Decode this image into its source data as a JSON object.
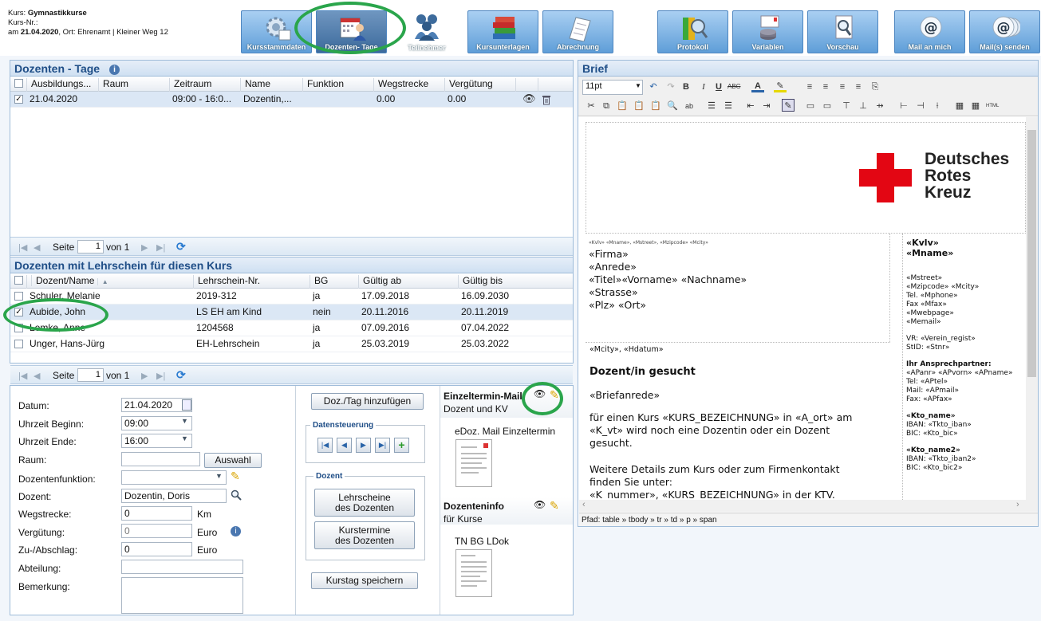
{
  "course": {
    "line1_label": "Kurs:",
    "line1_value": "Gymnastikkurse",
    "line2": "Kurs-Nr.:",
    "line3_pre": "am ",
    "line3_date": "21.04.2020",
    "line3_rest": ", Ort: Ehrenamt | Kleiner Weg 12"
  },
  "toolbar": {
    "kursstammdaten": "Kursstammdaten",
    "dozenten_tage": "Dozenten- Tage",
    "teilnehmer": "Teilnehmer",
    "kursunterlagen": "Kursunterlagen",
    "abrechnung": "Abrechnung",
    "protokoll": "Protokoll",
    "variablen": "Variablen",
    "vorschau": "Vorschau",
    "mail_an_mich": "Mail an mich",
    "mails_senden": "Mail(s) senden"
  },
  "colors": {
    "accent": "#1f4e87",
    "ring": "#2aa54b",
    "drk_red": "#e30613"
  },
  "tage": {
    "title": "Dozenten - Tage",
    "columns": [
      "Ausbildungs...",
      "Raum",
      "Zeitraum",
      "Name",
      "Funktion",
      "Wegstrecke",
      "Vergütung"
    ],
    "rows": [
      {
        "datum": "21.04.2020",
        "raum": "",
        "zeit": "09:00 - 16:0...",
        "name": "Dozentin,...",
        "funktion": "",
        "weg": "0.00",
        "verg": "0.00",
        "checked": true
      }
    ]
  },
  "pager1": {
    "seite": "Seite",
    "page": "1",
    "von": "von 1"
  },
  "lehrschein": {
    "title": "Dozenten mit Lehrschein für diesen Kurs",
    "columns": [
      "Dozent/Name",
      "Lehrschein-Nr.",
      "BG",
      "Gültig ab",
      "Gültig bis"
    ],
    "rows": [
      {
        "name": "Schuler, Melanie",
        "nr": "2019-312",
        "bg": "ja",
        "ab": "17.09.2018",
        "bis": "16.09.2030",
        "checked": false
      },
      {
        "name": "Aubide, John",
        "nr": "LS EH am Kind",
        "bg": "nein",
        "ab": "20.11.2016",
        "bis": "20.11.2019",
        "checked": true
      },
      {
        "name": "Lemke, Anne",
        "nr": "1204568",
        "bg": "ja",
        "ab": "07.09.2016",
        "bis": "07.04.2022",
        "checked": false
      },
      {
        "name": "Unger, Hans-Jürg",
        "nr": "EH-Lehrschein",
        "bg": "ja",
        "ab": "25.03.2019",
        "bis": "25.03.2022",
        "checked": false
      }
    ]
  },
  "pager2": {
    "seite": "Seite",
    "page": "1",
    "von": "von 1"
  },
  "form": {
    "datum_label": "Datum:",
    "datum": "21.04.2020",
    "beginn_label": "Uhrzeit Beginn:",
    "beginn": "09:00",
    "ende_label": "Uhrzeit Ende:",
    "ende": "16:00",
    "raum_label": "Raum:",
    "raum": "",
    "auswahl": "Auswahl",
    "funktion_label": "Dozentenfunktion:",
    "funktion": "",
    "dozent_label": "Dozent:",
    "dozent": "Dozentin, Doris",
    "weg_label": "Wegstrecke:",
    "weg": "0",
    "km": "Km",
    "verg_label": "Vergütung:",
    "verg": "0",
    "euro1": "Euro",
    "zu_label": "Zu-/Abschlag:",
    "zu": "0",
    "euro2": "Euro",
    "abt_label": "Abteilung:",
    "abt": "",
    "bem_label": "Bemerkung:",
    "bem": ""
  },
  "actions": {
    "add_tag": "Doz./Tag hinzufügen",
    "datensteuerung": "Datensteuerung",
    "dozent_group": "Dozent",
    "lehrscheine": "Lehrscheine",
    "lehrscheine2": "des Dozenten",
    "kurstermine": "Kurstermine",
    "kurstermine2": "des Dozenten",
    "speichern": "Kurstag speichern"
  },
  "einzeltermin": {
    "title": "Einzeltermin-Mail",
    "sub": "Dozent und KV",
    "doc": "eDoz. Mail Einzeltermin"
  },
  "dozenteninfo": {
    "title": "Dozenteninfo",
    "sub": "für Kurse",
    "doc": "TN BG LDok"
  },
  "brief": {
    "title": "Brief",
    "font_size": "11pt",
    "path": "Pfad: table » tbody » tr » td » p » span",
    "logo": [
      "Deutsches",
      "Rotes",
      "Kreuz"
    ],
    "sender_line": "«Kvlv» «Mname», «Mstreet», «Mzipcode» «Mcity»",
    "address": [
      "«Firma»",
      "«Anrede»",
      "«Titel»«Vorname» «Nachname»",
      "«Strasse»",
      "«Plz» «Ort»"
    ],
    "date_line": "«Mcity», «Hdatum»",
    "heading": "Dozent/in gesucht",
    "anrede": "«Briefanrede»",
    "p1": [
      "für einen Kurs «KURS_BEZEICHNUNG» in «A_ort» am",
      "«K_vt» wird noch eine Dozentin oder ein Dozent",
      "gesucht."
    ],
    "p2": [
      "Weitere Details zum Kurs oder zum Firmenkontakt",
      "finden Sie unter:",
      "«K_nummer», «KURS_BEZEICHNUNG» in der KTV."
    ],
    "side_bold": [
      "«Kvlv»",
      "«Mname»"
    ],
    "side1": [
      "«Mstreet»",
      "«Mzipcode» «Mcity»",
      "Tel. «Mphone»",
      "Fax «Mfax»",
      "«Mwebpage»",
      "«Memail»"
    ],
    "side2": [
      "VR: «Verein_regist»",
      "StID: «Stnr»"
    ],
    "side3_title": "Ihr Ansprechpartner:",
    "side3": [
      "«APanr» «APvorn» «APname»",
      "Tel: «APtel»",
      "Mail: «APmail»",
      "Fax: «APfax»"
    ],
    "side4_title": "«Kto_name»",
    "side4": [
      "IBAN: «Tkto_iban»",
      "BIC: «Kto_bic»"
    ],
    "side5_title": "«Kto_name2»",
    "side5": [
      "IBAN: «Tkto_iban2»",
      "BIC: «Kto_bic2»"
    ]
  }
}
